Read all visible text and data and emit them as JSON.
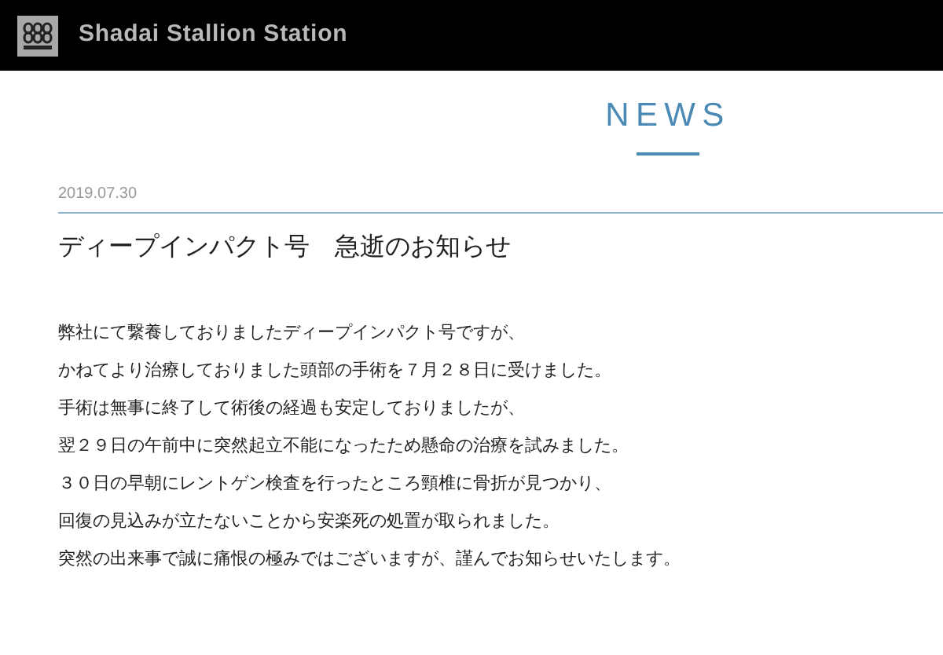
{
  "header": {
    "site_name": "Shadai Stallion Station"
  },
  "section_title": "NEWS",
  "article": {
    "date": "2019.07.30",
    "title": "ディープインパクト号　急逝のお知らせ",
    "paragraphs": [
      "弊社にて繋養しておりましたディープインパクト号ですが、",
      "かねてより治療しておりました頭部の手術を７月２８日に受けました。",
      "手術は無事に終了して術後の経過も安定しておりましたが、",
      "翌２９日の午前中に突然起立不能になったため懸命の治療を試みました。",
      "３０日の早朝にレントゲン検査を行ったところ頸椎に骨折が見つかり、",
      "回復の見込みが立たないことから安楽死の処置が取られました。",
      "突然の出来事で誠に痛恨の極みではございますが、謹んでお知らせいたします。"
    ]
  }
}
